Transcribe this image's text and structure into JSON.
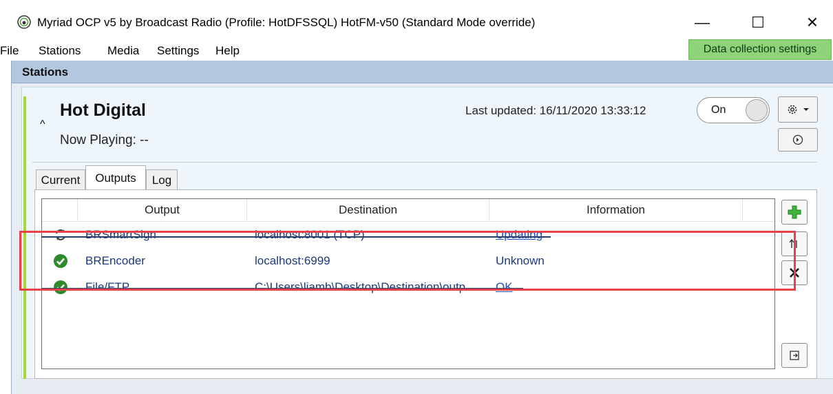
{
  "window": {
    "title": "Myriad OCP v5 by Broadcast Radio (Profile: HotDFSSQL) HotFM-v50 (Standard Mode override)",
    "minimize": "—",
    "maximize": "☐",
    "close": "✕"
  },
  "menu": {
    "items": [
      "File",
      "Stations",
      "Media",
      "Settings",
      "Help"
    ],
    "data_collection": "Data collection settings"
  },
  "stations": {
    "header": "Stations",
    "station": {
      "name": "Hot Digital",
      "now_playing": "Now Playing:  --",
      "last_updated": "Last updated: 16/11/2020 13:33:12",
      "toggle_label": "On",
      "collapse_glyph": "^"
    },
    "tabs": [
      "Current",
      "Outputs",
      "Log"
    ],
    "active_tab": "Outputs",
    "table": {
      "columns": [
        "Output",
        "Destination",
        "Information"
      ],
      "rows": [
        {
          "icon": "refresh-icon",
          "output": "BRSmartSign",
          "destination": "localhost:8001 (TCP)",
          "information": "Updating"
        },
        {
          "icon": "check-icon",
          "output": "BREncoder",
          "destination": "localhost:6999",
          "information": "Unknown"
        },
        {
          "icon": "check-icon",
          "output": "File/FTP",
          "destination": "C:\\Users\\liamb\\Desktop\\Destination\\outp",
          "information": "OK"
        }
      ]
    }
  },
  "colors": {
    "accent_green": "#8ed27a",
    "station_bar": "#a0d92f",
    "highlight": "#e5424a",
    "header_blue": "#b3c7de"
  }
}
